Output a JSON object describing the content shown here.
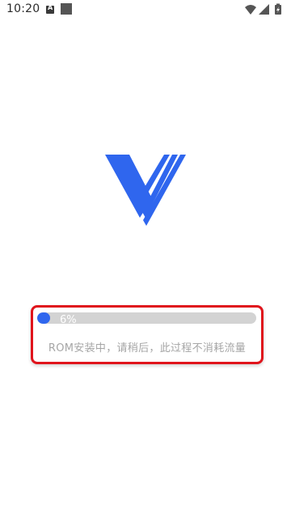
{
  "status_bar": {
    "time": "10:20",
    "icons": [
      "a-notification-icon",
      "square-notification-icon",
      "wifi-icon",
      "signal-icon",
      "battery-icon"
    ]
  },
  "logo": {
    "icon": "v-logo-icon",
    "color": "#2f66ee"
  },
  "installer": {
    "progress_fraction": 0.06,
    "progress_label": "6%",
    "message": "ROM安装中，请稍后，此过程不消耗流量",
    "track_color": "#d3d3d3",
    "fill_color": "#2f66ee",
    "highlight_color": "#e0141c"
  }
}
